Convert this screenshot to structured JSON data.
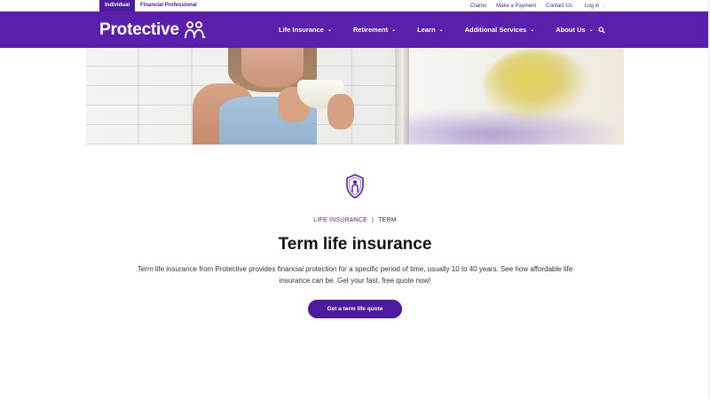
{
  "utility_bar": {
    "audience_tabs": [
      {
        "label": "Individual",
        "active": true
      },
      {
        "label": "Financial Professional",
        "active": false
      }
    ],
    "links": [
      "Claims",
      "Make a Payment",
      "Contact Us"
    ],
    "login_label": "Log in"
  },
  "brand": {
    "name": "Protective",
    "color": "#5a1fab"
  },
  "nav": {
    "items": [
      "Life Insurance",
      "Retirement",
      "Learn",
      "Additional Services",
      "About Us"
    ],
    "search_icon": "search-icon"
  },
  "hero": {
    "image_subject": "woman holding coffee cup"
  },
  "content": {
    "icon": "shield-person-icon",
    "breadcrumb_parent": "LIFE INSURANCE",
    "breadcrumb_sep": "|",
    "breadcrumb_current": "TERM",
    "title": "Term life insurance",
    "intro": "Term life insurance from Protective provides financial protection for a specific period of time, usually 10 to 40 years. See how affordable life insurance can be. Get your fast, free quote now!",
    "cta_label": "Get a term life quote"
  }
}
